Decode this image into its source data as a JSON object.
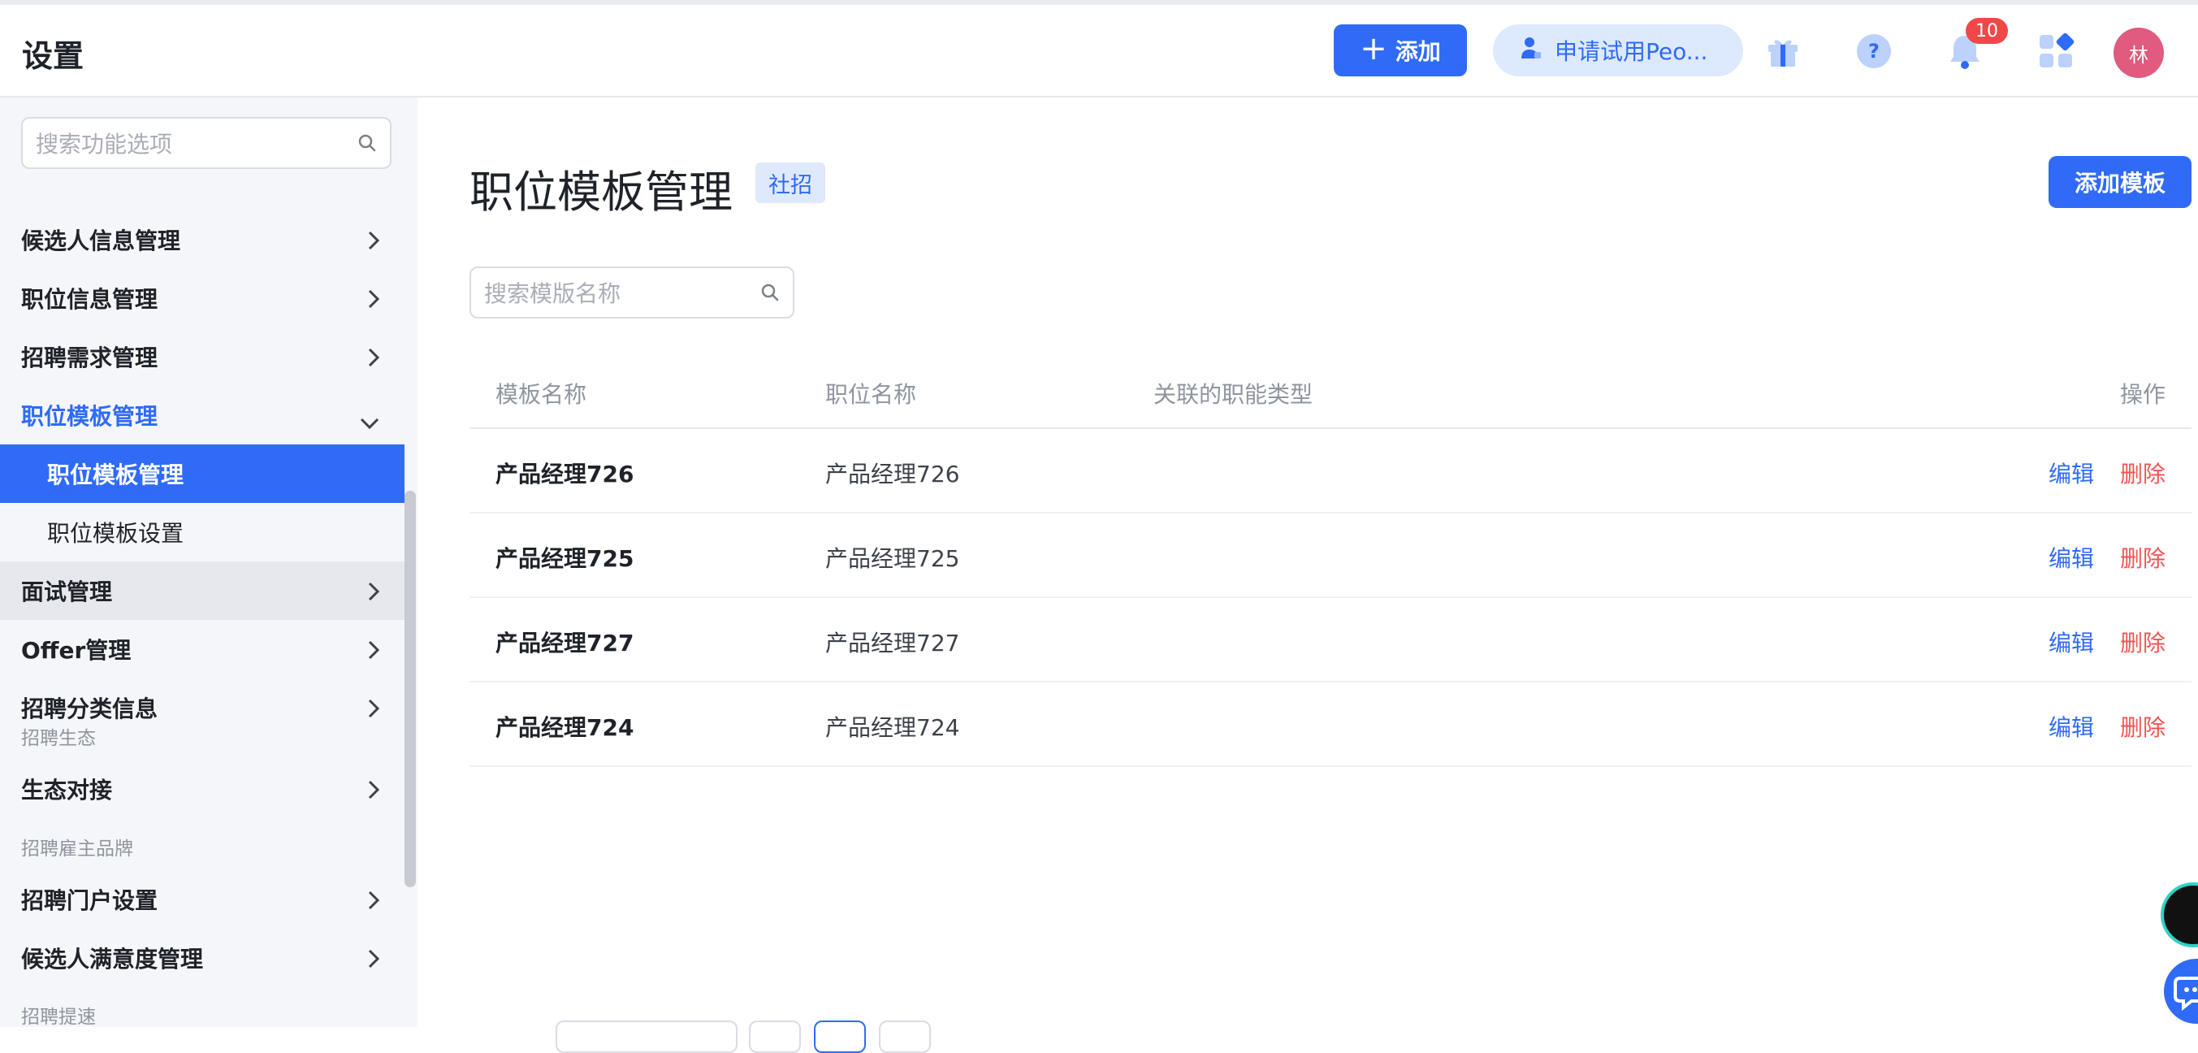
{
  "header": {
    "title": "设置",
    "add_label": "添加",
    "trial_label": "申请试用Peo...",
    "notification_count": "10",
    "avatar_text": "林"
  },
  "sidebar": {
    "search_placeholder": "搜索功能选项",
    "items": [
      {
        "label": "候选人信息管理"
      },
      {
        "label": "职位信息管理"
      },
      {
        "label": "招聘需求管理"
      },
      {
        "label": "职位模板管理",
        "expanded": true,
        "children": [
          {
            "label": "职位模板管理",
            "selected": true
          },
          {
            "label": "职位模板设置"
          }
        ]
      },
      {
        "label": "面试管理"
      },
      {
        "label": "Offer管理"
      },
      {
        "label": "招聘分类信息"
      }
    ],
    "group_eco": "招聘生态",
    "eco_items": [
      {
        "label": "生态对接"
      }
    ],
    "group_brand": "招聘雇主品牌",
    "brand_items": [
      {
        "label": "招聘门户设置"
      },
      {
        "label": "候选人满意度管理"
      }
    ],
    "group_speed": "招聘提速"
  },
  "main": {
    "title": "职位模板管理",
    "tag": "社招",
    "add_template_label": "添加模板",
    "search_placeholder": "搜索模版名称",
    "columns": [
      "模板名称",
      "职位名称",
      "关联的职能类型",
      "操作"
    ],
    "rows": [
      {
        "template": "产品经理726",
        "position": "产品经理726",
        "function_type": ""
      },
      {
        "template": "产品经理725",
        "position": "产品经理725",
        "function_type": ""
      },
      {
        "template": "产品经理727",
        "position": "产品经理727",
        "function_type": ""
      },
      {
        "template": "产品经理724",
        "position": "产品经理724",
        "function_type": ""
      }
    ],
    "edit_label": "编辑",
    "delete_label": "删除"
  },
  "colors": {
    "accent": "#2f6bf6",
    "danger": "#f05454",
    "sidebar_bg": "#f5f6fa",
    "avatar_bg": "#e05b7e"
  },
  "icons": [
    "plus-icon",
    "user-icon",
    "gift-icon",
    "help-icon",
    "bell-icon",
    "apps-icon",
    "search-icon",
    "chevron-right-icon",
    "chevron-down-icon"
  ]
}
